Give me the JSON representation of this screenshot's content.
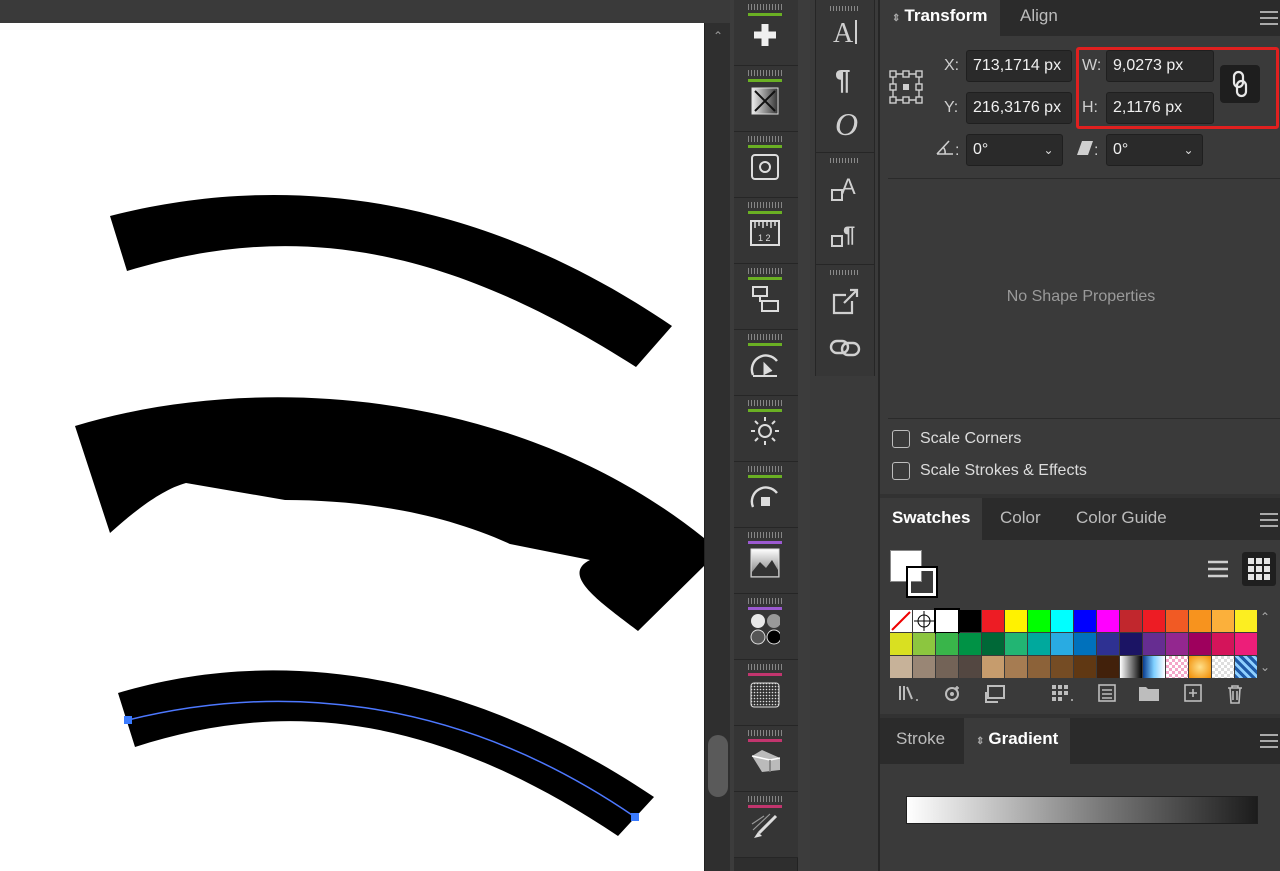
{
  "canvas": {
    "path_color": "#4d78ff",
    "anchor_color": "#3a7bff"
  },
  "tools_column1": [
    {
      "icon": "plus-icon",
      "bar_color": "#6ab023"
    },
    {
      "icon": "transparency-icon",
      "bar_color": "#6ab023"
    },
    {
      "icon": "symbols-icon",
      "bar_color": "#6ab023"
    },
    {
      "icon": "ruler-icon",
      "bar_color": "#6ab023"
    },
    {
      "icon": "asset-export-icon",
      "bar_color": "#6ab023"
    },
    {
      "icon": "graphic-styles-icon",
      "bar_color": "#6ab023"
    },
    {
      "icon": "brightness-icon",
      "bar_color": "#6ab023"
    },
    {
      "icon": "appearance-icon",
      "bar_color": "#6ab023"
    },
    {
      "icon": "image-icon",
      "bar_color": "#9b59d0"
    },
    {
      "icon": "swatch-libraries-icon",
      "bar_color": "#9b59d0"
    },
    {
      "icon": "texture-icon",
      "bar_color": "#c2356e"
    },
    {
      "icon": "3d-extrude-icon",
      "bar_color": "#c2356e"
    },
    {
      "icon": "brush-icon",
      "bar_color": "#c2356e"
    }
  ],
  "tools_column2": [
    "character-icon",
    "paragraph-icon",
    "opentype-icon",
    "character-styles-icon",
    "paragraph-styles-icon",
    "export-icon",
    "links-icon"
  ],
  "transform": {
    "tabs": [
      "Transform",
      "Align"
    ],
    "x_label": "X:",
    "x_value": "713,1714 px",
    "y_label": "Y:",
    "y_value": "216,3176 px",
    "w_label": "W:",
    "w_value": "9,0273 px",
    "h_label": "H:",
    "h_value": "2,1176 px",
    "angle_label": ":",
    "angle_value": "0°",
    "shear_label": ":",
    "shear_value": "0°",
    "no_shape": "No Shape Properties",
    "scale_corners": "Scale Corners",
    "scale_strokes": "Scale Strokes & Effects"
  },
  "swatches": {
    "tabs": [
      "Swatches",
      "Color",
      "Color Guide"
    ],
    "row1": [
      "none",
      "registration",
      "#ffffff",
      "#000000",
      "#ed1c24",
      "#fff200",
      "#00ff00",
      "#00ffff",
      "#0000ff",
      "#ff00ff",
      "#c1272d",
      "#ed1c24",
      "#f15a24",
      "#f7931e",
      "#fbb03b",
      "#fcee21"
    ],
    "row2": [
      "#d9e021",
      "#8cc63f",
      "#39b54a",
      "#009245",
      "#006837",
      "#22b573",
      "#00a99d",
      "#29abe2",
      "#0071bc",
      "#2e3192",
      "#1b1464",
      "#662d91",
      "#93278f",
      "#9e005d",
      "#d4145a",
      "#ed1e79"
    ],
    "row3": [
      "#c7b299",
      "#998675",
      "#736357",
      "#534741",
      "#c69c6d",
      "#a67c52",
      "#8c6239",
      "#754c24",
      "#603813",
      "#42210b",
      "gradient-bw",
      "gradient-blue",
      "pattern-pink",
      "gradient-orange",
      "pattern-check",
      "pattern-blue"
    ]
  },
  "gradient": {
    "tabs": [
      "Stroke",
      "Gradient"
    ]
  }
}
